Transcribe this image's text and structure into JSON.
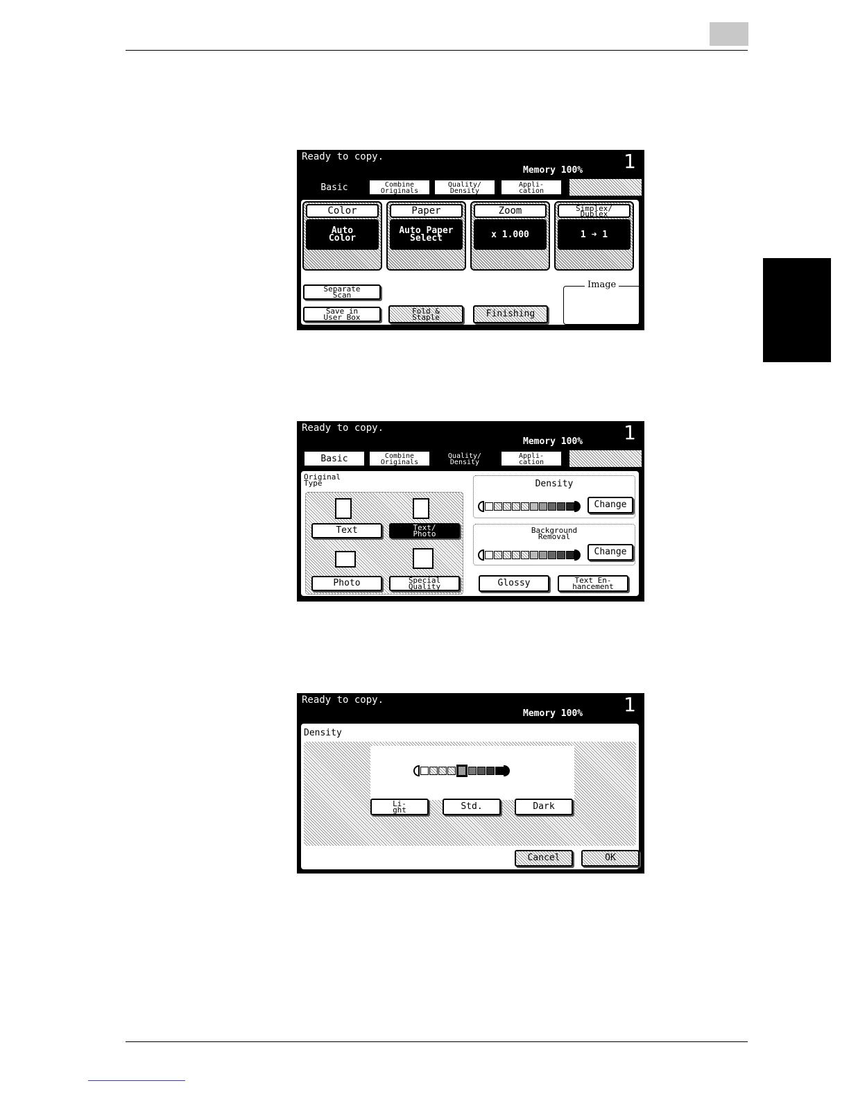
{
  "screens": [
    {
      "status": "Ready to copy.",
      "memory": "Memory  100%",
      "copies": "1",
      "tabs": [
        "Basic",
        "Combine\nOriginals",
        "Quality/\nDensity",
        "Appli-\ncation"
      ],
      "functions": [
        {
          "title": "Color",
          "value": "Auto\nColor"
        },
        {
          "title": "Paper",
          "value": "Auto Paper\nSelect"
        },
        {
          "title": "Zoom",
          "value": "x 1.000"
        },
        {
          "title": "Simplex/\nDuplex",
          "value": "1 ➜ 1"
        }
      ],
      "buttons": {
        "separate_scan": "Separate\nScan",
        "save_user_box": "Save in\nUser Box",
        "fold_staple": "Fold &\nStaple",
        "finishing": "Finishing"
      },
      "image_label": "Image"
    },
    {
      "status": "Ready to copy.",
      "memory": "Memory  100%",
      "copies": "1",
      "tabs": [
        "Basic",
        "Combine\nOriginals",
        "Quality/\nDensity",
        "Appli-\ncation"
      ],
      "original_type_label": "Original\nType",
      "types": [
        "Text",
        "Text/\nPhoto",
        "Photo",
        "Special\nQuality"
      ],
      "density_label": "Density",
      "background_label": "Background\nRemoval",
      "change_label": "Change",
      "glossy_label": "Glossy",
      "text_enh_label": "Text En-\nhancement"
    },
    {
      "status": "Ready to copy.",
      "memory": "Memory  100%",
      "copies": "1",
      "density_title": "Density",
      "light_label": "Li-\nght",
      "std_label": "Std.",
      "dark_label": "Dark",
      "cancel_label": "Cancel",
      "ok_label": "OK"
    }
  ]
}
